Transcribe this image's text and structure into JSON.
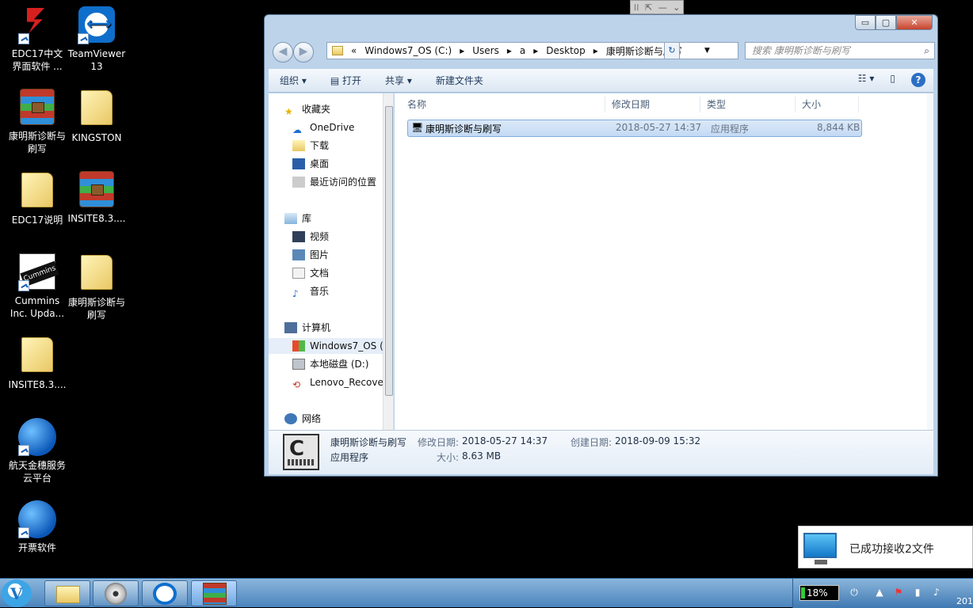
{
  "desktop": {
    "icons": [
      {
        "label": "EDC17中文界面软件 ...",
        "icon": "edc17-app-icon"
      },
      {
        "label": "TeamViewer 13",
        "icon": "teamviewer-icon"
      },
      {
        "label": "康明斯诊断与刷写",
        "icon": "winrar-archive-icon"
      },
      {
        "label": "KINGSTON",
        "icon": "folder-icon"
      },
      {
        "label": "EDC17说明",
        "icon": "folder-icon"
      },
      {
        "label": "INSITE8.3....",
        "icon": "winrar-archive-icon"
      },
      {
        "label": "Cummins Inc. Upda...",
        "icon": "cummins-icon"
      },
      {
        "label": "康明斯诊断与刷写",
        "icon": "folder-icon"
      },
      {
        "label": "INSITE8.3....",
        "icon": "folder-icon"
      },
      {
        "label": "航天金穗服务云平台",
        "icon": "aisino-icon"
      },
      {
        "label": "开票软件",
        "icon": "aisino-icon"
      }
    ]
  },
  "remote_bar": {
    "grip": "⁞⁞",
    "expand": "⇱",
    "minimize": "—",
    "chevron": "⌄"
  },
  "explorer": {
    "title_buttons": {
      "minimize": "▭",
      "maximize": "▢",
      "close": "✕"
    },
    "nav": {
      "back": "◀",
      "forward": "▶"
    },
    "address": {
      "prefix": "«",
      "crumbs": [
        "Windows7_OS (C:)",
        "Users",
        "a",
        "Desktop",
        "康明斯诊断与刷写"
      ],
      "dropdown": "▼"
    },
    "refresh": "↻",
    "search": {
      "placeholder": "搜索 康明斯诊断与刷写",
      "icon": "search-icon"
    },
    "toolbar": {
      "organize": "组织 ▾",
      "open": "打开",
      "share": "共享 ▾",
      "new_folder": "新建文件夹",
      "views": "☷ ▾",
      "preview": "▯",
      "help": "?"
    },
    "navpane": {
      "favorites": "收藏夹",
      "onedrive": "OneDrive",
      "downloads": "下载",
      "desktop": "桌面",
      "recent": "最近访问的位置",
      "libraries": "库",
      "videos": "视频",
      "pictures": "图片",
      "documents": "文档",
      "music": "音乐",
      "computer": "计算机",
      "drive_c": "Windows7_OS (",
      "drive_d": "本地磁盘 (D:)",
      "drive_recovery": "Lenovo_Recove",
      "network": "网络"
    },
    "columns": {
      "name": "名称",
      "modified": "修改日期",
      "type": "类型",
      "size": "大小"
    },
    "files": [
      {
        "name": "康明斯诊断与刷写",
        "modified": "2018-05-27 14:37",
        "type": "应用程序",
        "size": "8,844 KB"
      }
    ],
    "details": {
      "name": "康明斯诊断与刷写",
      "type": "应用程序",
      "modified_label": "修改日期:",
      "modified": "2018-05-27 14:37",
      "created_label": "创建日期:",
      "created": "2018-09-09 15:32",
      "size_label": "大小:",
      "size": "8.63 MB"
    }
  },
  "notification": {
    "message": "已成功接收2文件"
  },
  "taskbar": {
    "battery_percent": "18%",
    "clock_partial": "201"
  }
}
